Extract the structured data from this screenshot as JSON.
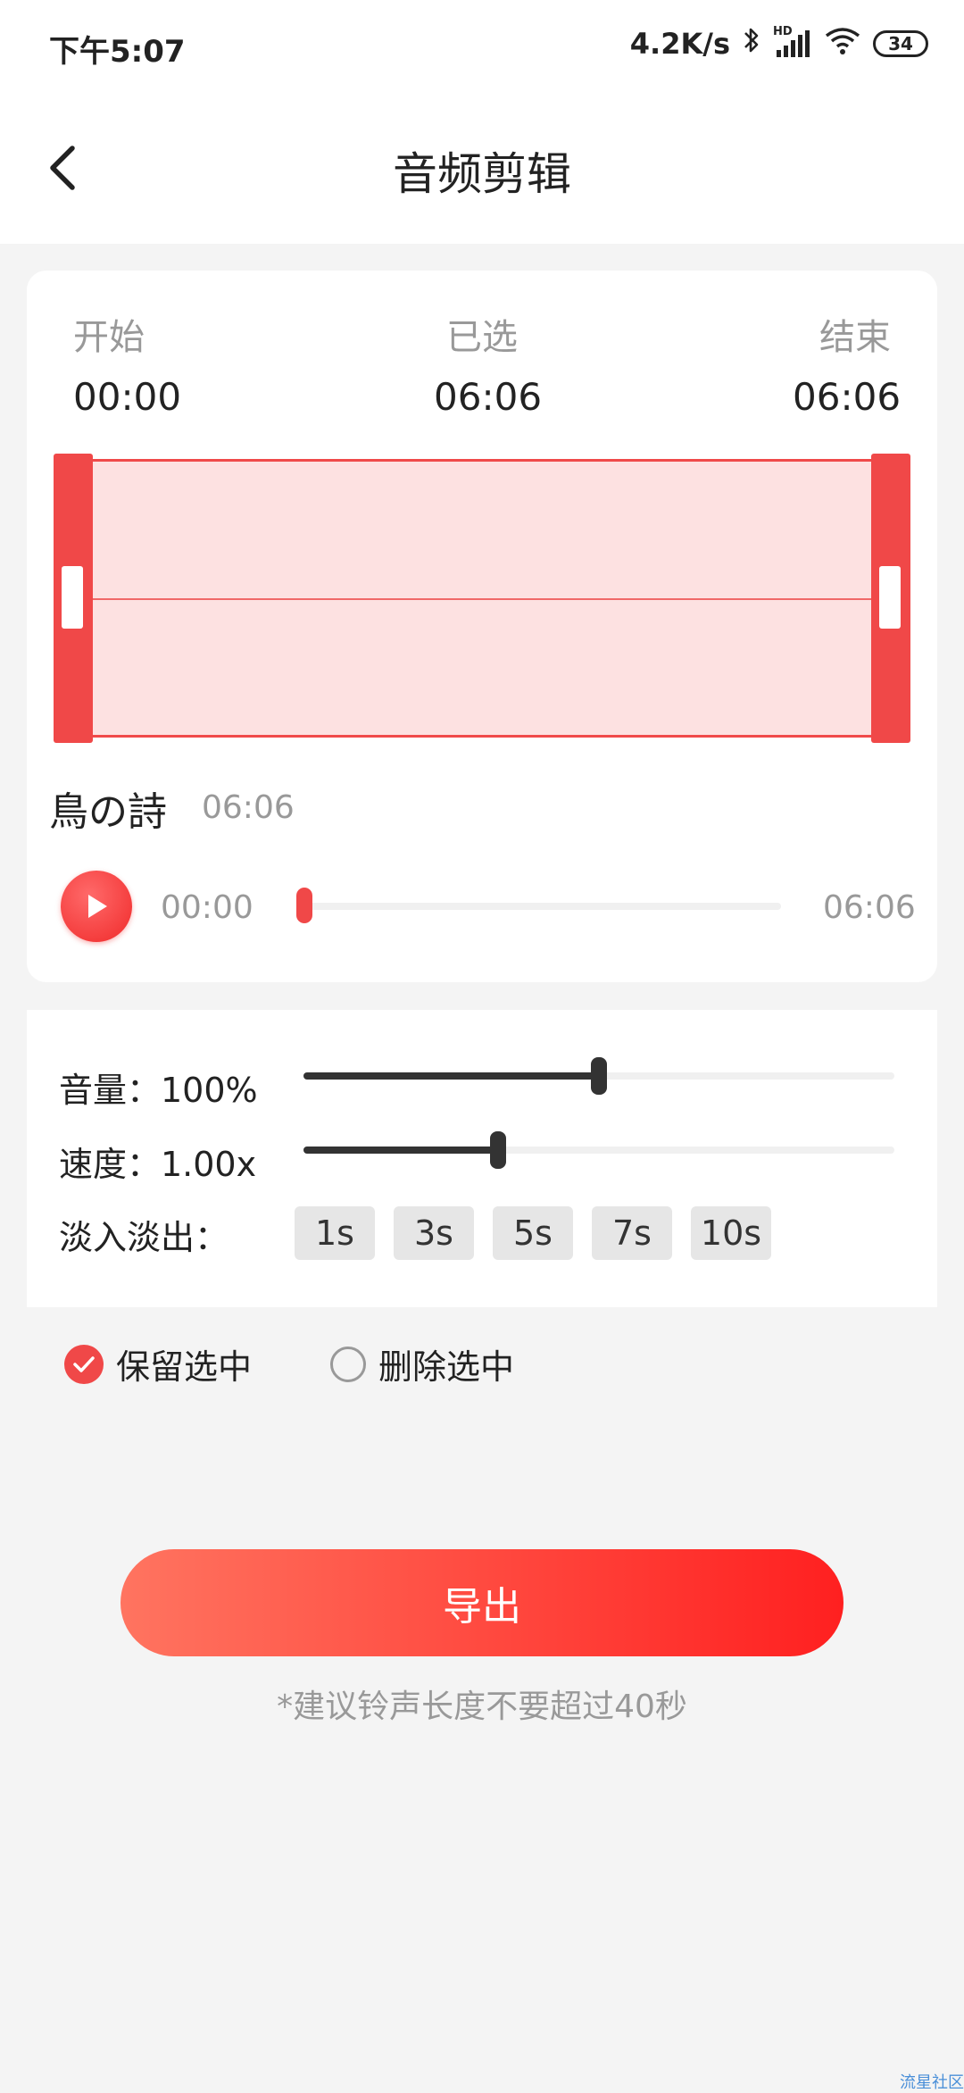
{
  "status_bar": {
    "time": "下午5:07",
    "network_speed": "4.2K/s",
    "hd_label": "HD",
    "battery": "34",
    "icons": [
      "bluetooth-icon",
      "signal-icon",
      "wifi-icon",
      "battery-icon"
    ]
  },
  "header": {
    "title": "音频剪辑",
    "back_icon": "chevron-left-icon"
  },
  "range": {
    "start_label": "开始",
    "start_value": "00:00",
    "selected_label": "已选",
    "selected_value": "06:06",
    "end_label": "结束",
    "end_value": "06:06"
  },
  "track": {
    "name": "鳥の詩",
    "duration": "06:06"
  },
  "player": {
    "current": "00:00",
    "total": "06:06",
    "progress": 0
  },
  "adjust": {
    "volume_label": "音量：100%",
    "volume_level": 0.5,
    "speed_label": "速度：1.00x",
    "speed_level": 0.33,
    "fade_label": "淡入淡出：",
    "fade_options": [
      "1s",
      "3s",
      "5s",
      "7s",
      "10s"
    ]
  },
  "options": {
    "keep_label": "保留选中",
    "keep_checked": true,
    "delete_label": "删除选中",
    "delete_checked": false
  },
  "export": {
    "button_label": "导出",
    "hint": "*建议铃声长度不要超过40秒"
  },
  "watermark": "流星社区",
  "colors": {
    "accent": "#f04848",
    "wave_fill": "#fde1e1",
    "background": "#f4f4f4"
  }
}
